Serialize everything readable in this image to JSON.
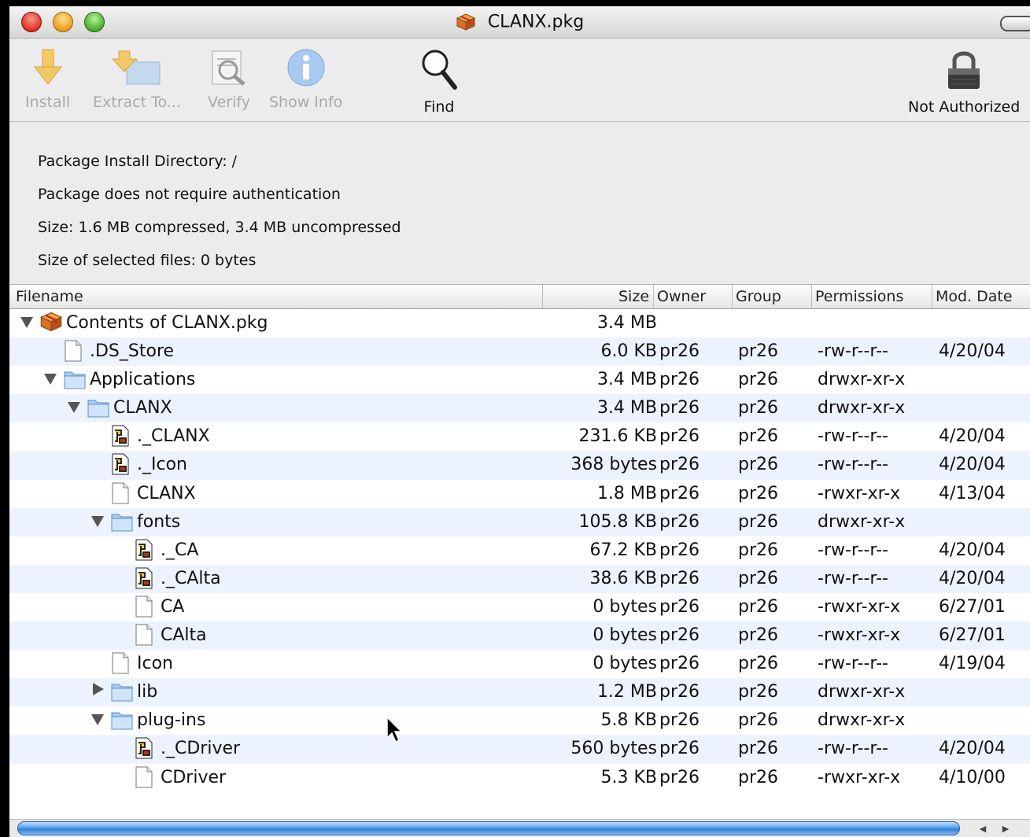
{
  "window": {
    "title": "CLANX.pkg"
  },
  "toolbar": {
    "install": "Install",
    "extract": "Extract To...",
    "verify": "Verify",
    "show_info": "Show Info",
    "find": "Find",
    "auth": "Not Authorized"
  },
  "info": {
    "install_dir": "Package Install Directory: /",
    "auth_note": "Package does not require authentication",
    "size": "Size: 1.6 MB compressed, 3.4 MB uncompressed",
    "selected": "Size of selected files: 0 bytes"
  },
  "columns": {
    "filename": "Filename",
    "size": "Size",
    "owner": "Owner",
    "group": "Group",
    "permissions": "Permissions",
    "mod_date": "Mod. Date"
  },
  "rows": [
    {
      "name": "Contents of CLANX.pkg",
      "size": "3.4 MB",
      "owner": "",
      "group": "",
      "perm": "",
      "date": "",
      "icon": "package-icon",
      "expand": "open"
    },
    {
      "name": ".DS_Store",
      "size": "6.0 KB",
      "owner": "pr26",
      "group": "pr26",
      "perm": "-rw-r--r--",
      "date": "4/20/04",
      "icon": "document-icon",
      "expand": ""
    },
    {
      "name": "Applications",
      "size": "3.4 MB",
      "owner": "pr26",
      "group": "pr26",
      "perm": "drwxr-xr-x",
      "date": "",
      "icon": "folder-icon",
      "expand": "open"
    },
    {
      "name": "CLANX",
      "size": "3.4 MB",
      "owner": "pr26",
      "group": "pr26",
      "perm": "drwxr-xr-x",
      "date": "",
      "icon": "folder-icon",
      "expand": "open"
    },
    {
      "name": "._CLANX",
      "size": "231.6 KB",
      "owner": "pr26",
      "group": "pr26",
      "perm": "-rw-r--r--",
      "date": "4/20/04",
      "icon": "resource-file-icon",
      "expand": ""
    },
    {
      "name": "._Icon",
      "size": "368 bytes",
      "owner": "pr26",
      "group": "pr26",
      "perm": "-rw-r--r--",
      "date": "4/20/04",
      "icon": "resource-file-icon",
      "expand": ""
    },
    {
      "name": "CLANX",
      "size": "1.8 MB",
      "owner": "pr26",
      "group": "pr26",
      "perm": "-rwxr-xr-x",
      "date": "4/13/04",
      "icon": "document-icon",
      "expand": ""
    },
    {
      "name": "fonts",
      "size": "105.8 KB",
      "owner": "pr26",
      "group": "pr26",
      "perm": "drwxr-xr-x",
      "date": "",
      "icon": "folder-icon",
      "expand": "open"
    },
    {
      "name": "._CA",
      "size": "67.2 KB",
      "owner": "pr26",
      "group": "pr26",
      "perm": "-rw-r--r--",
      "date": "4/20/04",
      "icon": "resource-file-icon",
      "expand": ""
    },
    {
      "name": "._CAlta",
      "size": "38.6 KB",
      "owner": "pr26",
      "group": "pr26",
      "perm": "-rw-r--r--",
      "date": "4/20/04",
      "icon": "resource-file-icon",
      "expand": ""
    },
    {
      "name": "CA",
      "size": "0 bytes",
      "owner": "pr26",
      "group": "pr26",
      "perm": "-rwxr-xr-x",
      "date": "6/27/01",
      "icon": "document-icon",
      "expand": ""
    },
    {
      "name": "CAlta",
      "size": "0 bytes",
      "owner": "pr26",
      "group": "pr26",
      "perm": "-rwxr-xr-x",
      "date": "6/27/01",
      "icon": "document-icon",
      "expand": ""
    },
    {
      "name": "Icon",
      "size": "0 bytes",
      "owner": "pr26",
      "group": "pr26",
      "perm": "-rw-r--r--",
      "date": "4/19/04",
      "icon": "document-icon",
      "expand": ""
    },
    {
      "name": "lib",
      "size": "1.2 MB",
      "owner": "pr26",
      "group": "pr26",
      "perm": "drwxr-xr-x",
      "date": "",
      "icon": "folder-icon",
      "expand": "closed"
    },
    {
      "name": "plug-ins",
      "size": "5.8 KB",
      "owner": "pr26",
      "group": "pr26",
      "perm": "drwxr-xr-x",
      "date": "",
      "icon": "folder-icon",
      "expand": "open"
    },
    {
      "name": "._CDriver",
      "size": "560 bytes",
      "owner": "pr26",
      "group": "pr26",
      "perm": "-rw-r--r--",
      "date": "4/20/04",
      "icon": "resource-file-icon",
      "expand": ""
    },
    {
      "name": "CDriver",
      "size": "5.3 KB",
      "owner": "pr26",
      "group": "pr26",
      "perm": "-rwxr-xr-x",
      "date": "4/10/00",
      "icon": "document-icon",
      "expand": ""
    }
  ]
}
